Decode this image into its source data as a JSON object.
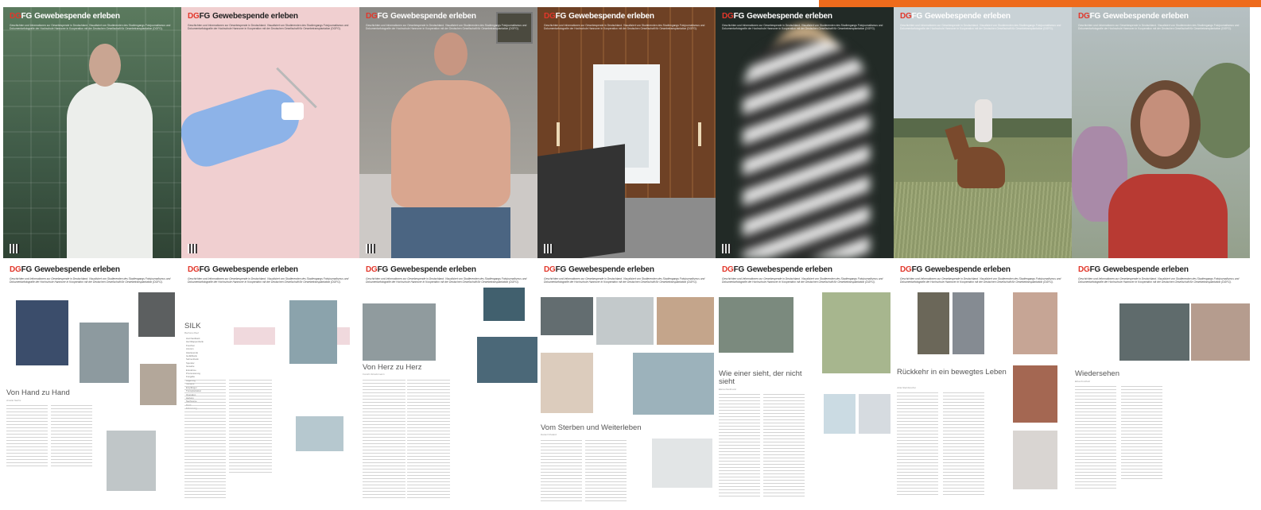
{
  "brand": {
    "logo_dg": "DG",
    "logo_fg": "FG",
    "name": "Gewebespende erleben",
    "subtitle": "Geschichten und Informationen zur Gewebespende in Deutschland. Visualisiert von Studierenden des Studiengangs Fotojournalismus und Dokumentarfotografie der Hochschule Hannover in Kooperation mit der Deutschen Gesellschaft für Gewebetransplantation (DGFG)."
  },
  "colors": {
    "accent_bar": "#ee6b1c",
    "logo_red": "#e2372b"
  },
  "articles": [
    {
      "title": "Von Hand zu Hand",
      "author": "Amelie Sachs"
    },
    {
      "title": "SILK",
      "author": "Barbara Maul",
      "list_items": [
        "Hornhautbank",
        "Herzklappenbank",
        "Knochen",
        "Amnion",
        "Hautspende",
        "Gefäßbank",
        "Sehnenbank",
        "Spender",
        "Gewebe",
        "Entnahme",
        "Prozessierung",
        "Freigabe",
        "Lagerung",
        "Versand",
        "Empfänger",
        "Transplantation",
        "Operation",
        "Heilung",
        "Nachsorge",
        "Dank",
        "Erinnerung"
      ]
    },
    {
      "title": "Von Herz zu Herz",
      "author": "Carolin Sündermann"
    },
    {
      "title": "Vom Sterben und Weiterleben",
      "author": "Daniel Chatard"
    },
    {
      "title": "Wie einer sieht, der nicht sieht",
      "author": "Elena Kaufmann"
    },
    {
      "title": "Rückkehr in ein bewegtes Leben",
      "author": "Julia Steinbrecher"
    },
    {
      "title": "Wiedersehen",
      "author": "Elisa Kurzbein"
    }
  ]
}
